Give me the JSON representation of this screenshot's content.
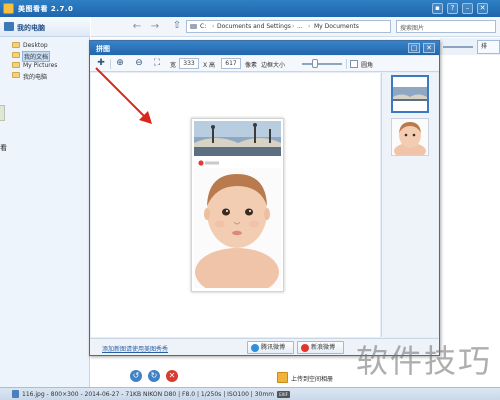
{
  "app": {
    "title": "美图看看 2.7.0"
  },
  "left_pane": {
    "header": "我的电脑",
    "items": [
      {
        "label": "Desktop",
        "selected": false
      },
      {
        "label": "我的文档",
        "selected": true
      },
      {
        "label": "My Pictures",
        "selected": false
      },
      {
        "label": "我的电脑",
        "selected": false
      }
    ],
    "edge_text": "看"
  },
  "address": {
    "segments": [
      "C:",
      "Documents and Settings",
      "...",
      "My Documents"
    ],
    "search_placeholder": "搜索图片"
  },
  "background_button": "排",
  "dialog": {
    "title": "拼图",
    "toolbar": {
      "width_label": "宽",
      "width_value": "333",
      "height_label": "X 高",
      "height_value": "617",
      "unit": "像素",
      "spacing_label": "边框大小",
      "corner_label": "圆角"
    },
    "bottom_link": "添加新图请使用美图秀秀",
    "share_buttons": [
      {
        "label": "腾讯微博",
        "color": "#2f8fd8"
      },
      {
        "label": "新浪微博",
        "color": "#e2362c"
      }
    ]
  },
  "main_bottom": {
    "upload_label": "上传到空间相册"
  },
  "status": {
    "text": "116.jpg - 800×300 - 2014-06-27 - 71KB  NIKON D80 | F8.0 | 1/250s | ISO100 | 30mm",
    "exif": "EXIF"
  },
  "watermark": "软件技巧",
  "colors": {
    "title_blue": "#2470b8",
    "selection": "#3b79c2",
    "arrow": "#d9271c"
  }
}
